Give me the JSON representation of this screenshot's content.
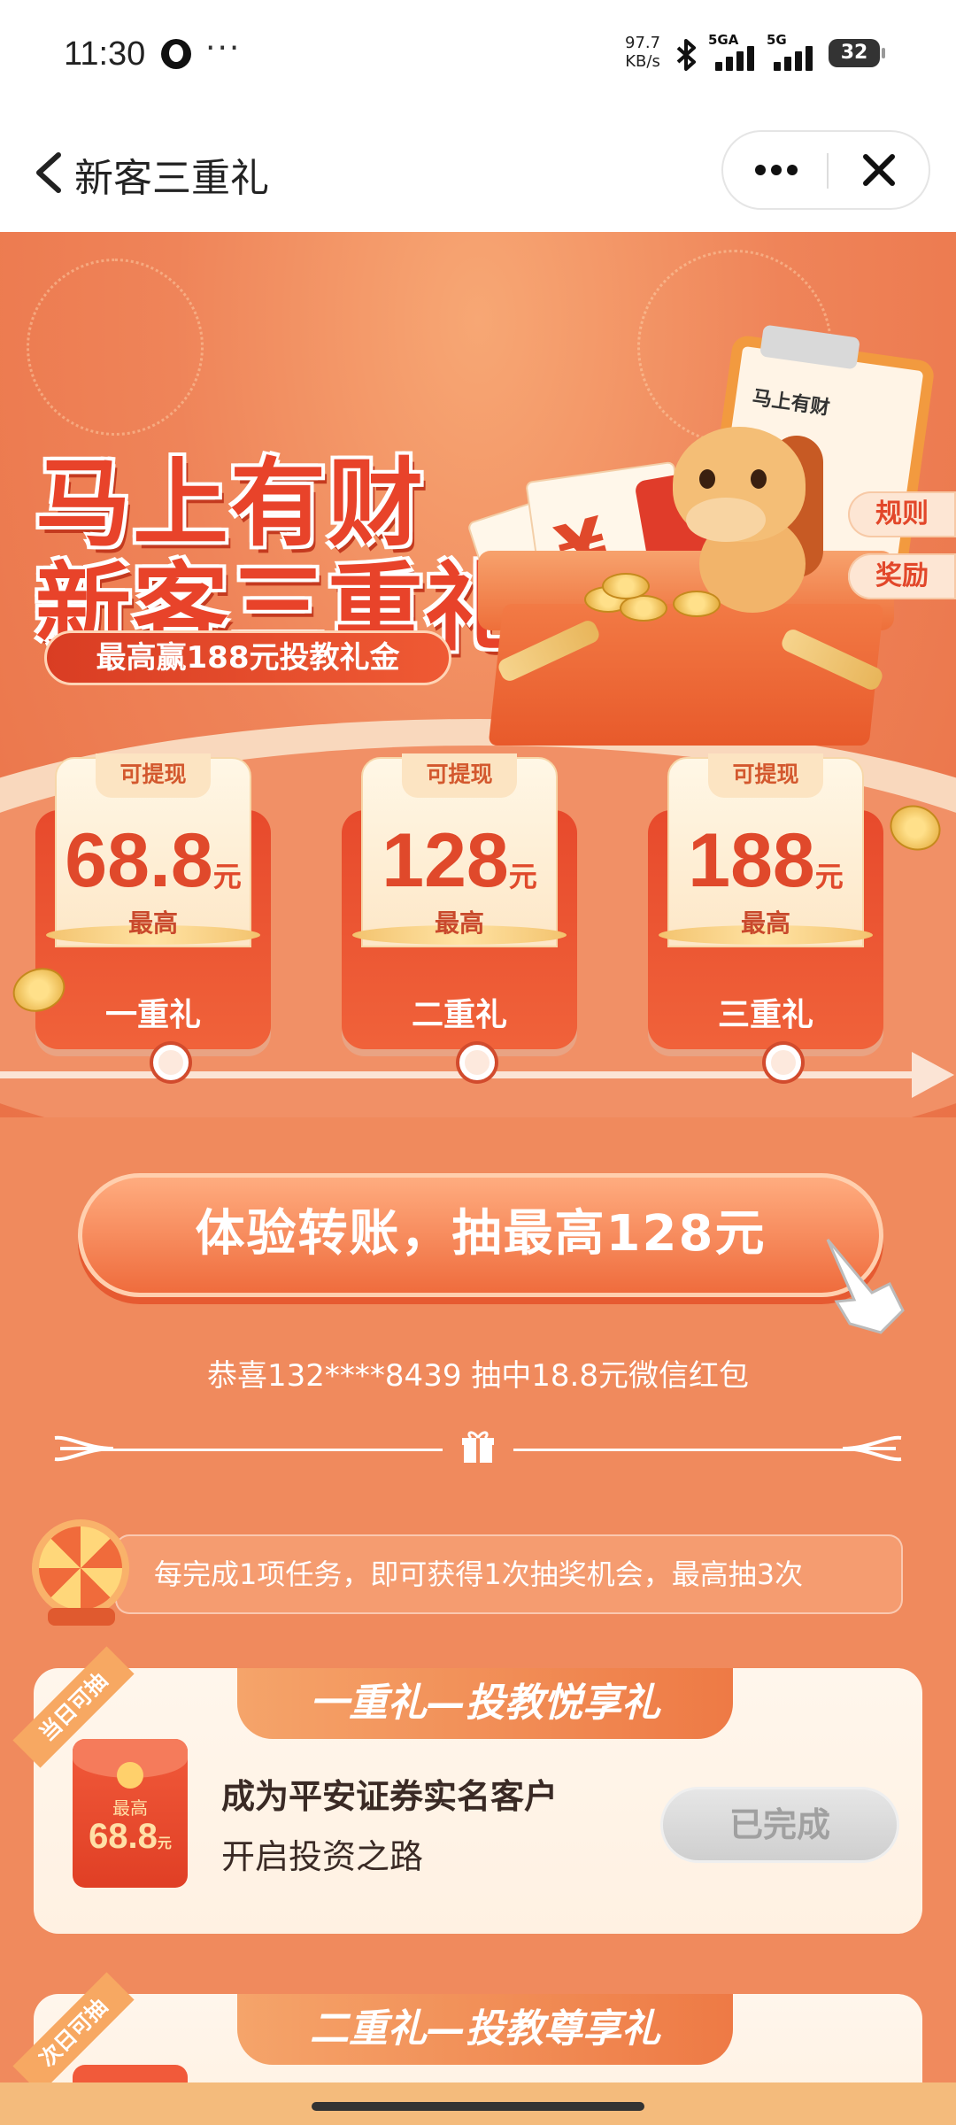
{
  "status_bar": {
    "time": "11:30",
    "net_speed_value": "97.7",
    "net_speed_unit": "KB/s",
    "signal1_label": "5GA",
    "signal2_label": "5G",
    "battery": "32"
  },
  "nav": {
    "title": "新客三重礼"
  },
  "hero": {
    "title_line1": "马上有财",
    "title_line2": "新客三重礼",
    "subtitle": "最高赢188元投教礼金",
    "clipboard_label": "马上有财",
    "rules_tab": "规则",
    "rewards_tab": "奖励"
  },
  "cards": [
    {
      "tag": "可提现",
      "amount": "68.8",
      "unit": "元",
      "max": "最高",
      "name": "一重礼"
    },
    {
      "tag": "可提现",
      "amount": "128",
      "unit": "元",
      "max": "最高",
      "name": "二重礼"
    },
    {
      "tag": "可提现",
      "amount": "188",
      "unit": "元",
      "max": "最高",
      "name": "三重礼"
    }
  ],
  "cta": {
    "label": "体验转账，抽最高128元"
  },
  "winner_text": "恭喜132****8439 抽中18.8元微信红包",
  "tip": "每完成1项任务，即可获得1次抽奖机会，最高抽3次",
  "tasks": [
    {
      "corner": "当日可抽",
      "header": "一重礼—投教悦享礼",
      "packet_max": "最高",
      "packet_amount": "68.8",
      "packet_unit": "元",
      "title": "成为平安证券实名客户",
      "subtitle": "开启投资之路",
      "button": "已完成"
    },
    {
      "corner": "次日可抽",
      "header": "二重礼—投教尊享礼"
    }
  ],
  "colors": {
    "background": "#f08a5d",
    "accent_red": "#e0492b",
    "cream": "#fff6ec"
  }
}
